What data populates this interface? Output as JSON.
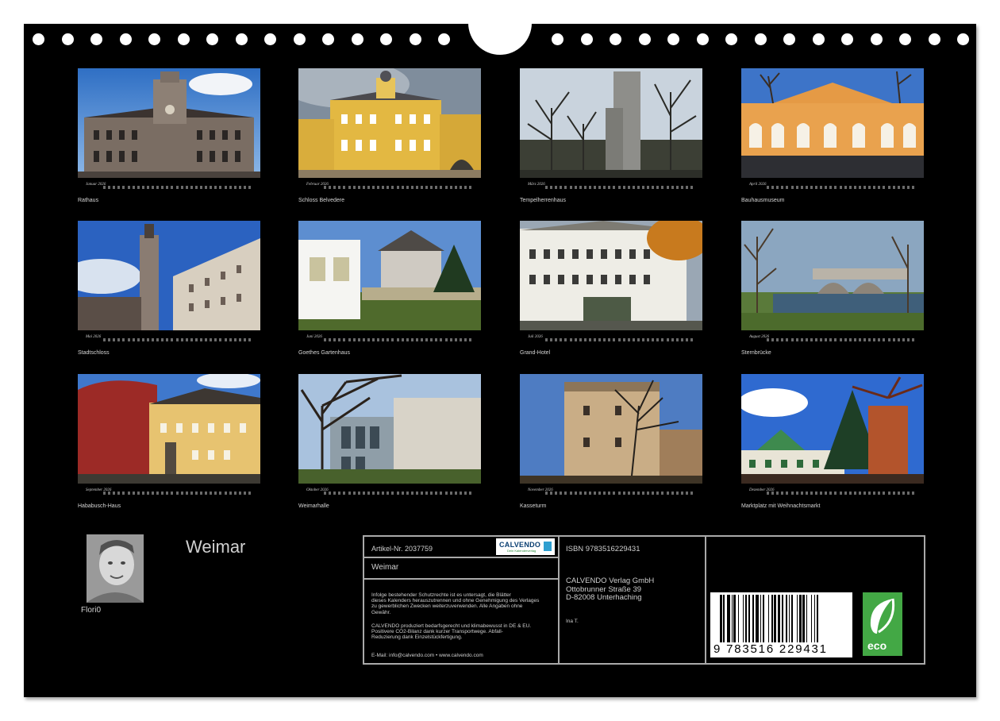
{
  "calendar_title": "Weimar",
  "photographer": "Flori0",
  "colors": {
    "background": "#000000",
    "text": "#cfcfcf",
    "frame": "#a9a9a9",
    "eco_green": "#43a845",
    "logo_blue": "#0a3f72"
  },
  "months": [
    {
      "month": "Januar 2026",
      "caption": "Rathaus"
    },
    {
      "month": "Februar 2026",
      "caption": "Schloss Belvedere"
    },
    {
      "month": "März 2026",
      "caption": "Tempelherrenhaus"
    },
    {
      "month": "April 2026",
      "caption": "Bauhausmuseum"
    },
    {
      "month": "Mai 2026",
      "caption": "Stadtschloss"
    },
    {
      "month": "Juni 2026",
      "caption": "Goethes Gartenhaus"
    },
    {
      "month": "Juli 2026",
      "caption": "Grand-Hotel"
    },
    {
      "month": "August 2026",
      "caption": "Sternbrücke"
    },
    {
      "month": "September 2026",
      "caption": "Hababusch-Haus"
    },
    {
      "month": "Oktober 2026",
      "caption": "Weimarhalle"
    },
    {
      "month": "November 2026",
      "caption": "Kasseturm"
    },
    {
      "month": "Dezember 2026",
      "caption": "Marktplatz mit Weihnachtsmarkt"
    }
  ],
  "info": {
    "article": "Artikel-Nr. 2037759",
    "logo_text": "CALVENDO",
    "logo_sub": "Dein Kalenderverlag",
    "title": "Weimar",
    "legal_lines": [
      "Infolge bestehender Schutzrechte ist es untersagt, die Blätter",
      "dieses Kalenders herauszutrennen und ohne Genehmigung des Verlages",
      "zu gewerblichen Zwecken weiterzuverwenden. Alle Angaben ohne",
      "Gewähr."
    ],
    "eco_lines": [
      "CALVENDO produziert bedarfsgerecht und klimabewusst in DE & EU.",
      "Positivere CO2-Bilanz dank kurzer Transportwege. Abfall-",
      "Reduzierung dank Einzelstückfertigung."
    ],
    "contact": "E-Mail: info@calvendo.com • www.calvendo.com",
    "isbn": "ISBN 9783516229431",
    "publisher_lines": [
      "CALVENDO Verlag GmbH",
      "Ottobrunner Straße 39",
      "D-82008 Unterhaching"
    ],
    "author": "Ina T.",
    "barcode_number": "9 783516 229431",
    "eco_label": "eco"
  }
}
